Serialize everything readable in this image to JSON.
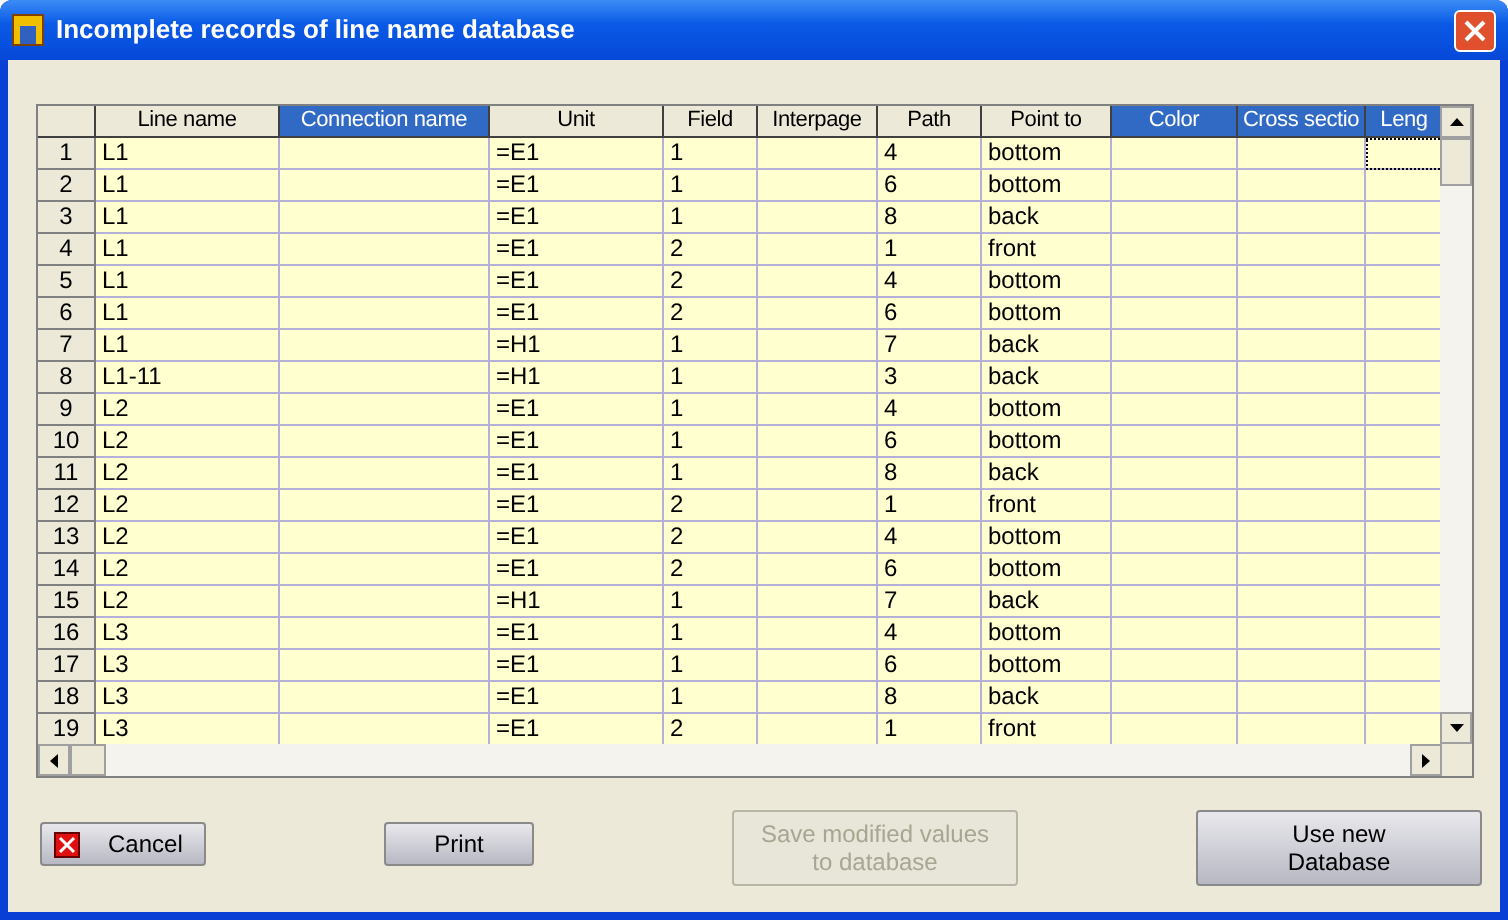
{
  "window": {
    "title": "Incomplete records of line name database"
  },
  "table": {
    "columns": [
      {
        "label": "Line name",
        "selected": false
      },
      {
        "label": "Connection name",
        "selected": true
      },
      {
        "label": "Unit",
        "selected": false
      },
      {
        "label": "Field",
        "selected": false
      },
      {
        "label": "Interpage",
        "selected": false
      },
      {
        "label": "Path",
        "selected": false
      },
      {
        "label": "Point to",
        "selected": false
      },
      {
        "label": "Color",
        "selected": true
      },
      {
        "label": "Cross sectio",
        "selected": true
      },
      {
        "label": "Leng",
        "selected": true
      }
    ],
    "rows": [
      {
        "number": "1",
        "line_name": "L1",
        "unit": "=E1",
        "field": "1",
        "path": "4",
        "point_to": "bottom"
      },
      {
        "number": "2",
        "line_name": "L1",
        "unit": "=E1",
        "field": "1",
        "path": "6",
        "point_to": "bottom"
      },
      {
        "number": "3",
        "line_name": "L1",
        "unit": "=E1",
        "field": "1",
        "path": "8",
        "point_to": "back"
      },
      {
        "number": "4",
        "line_name": "L1",
        "unit": "=E1",
        "field": "2",
        "path": "1",
        "point_to": "front"
      },
      {
        "number": "5",
        "line_name": "L1",
        "unit": "=E1",
        "field": "2",
        "path": "4",
        "point_to": "bottom"
      },
      {
        "number": "6",
        "line_name": "L1",
        "unit": "=E1",
        "field": "2",
        "path": "6",
        "point_to": "bottom"
      },
      {
        "number": "7",
        "line_name": "L1",
        "unit": "=H1",
        "field": "1",
        "path": "7",
        "point_to": "back"
      },
      {
        "number": "8",
        "line_name": "L1-11",
        "unit": "=H1",
        "field": "1",
        "path": "3",
        "point_to": "back"
      },
      {
        "number": "9",
        "line_name": "L2",
        "unit": "=E1",
        "field": "1",
        "path": "4",
        "point_to": "bottom"
      },
      {
        "number": "10",
        "line_name": "L2",
        "unit": "=E1",
        "field": "1",
        "path": "6",
        "point_to": "bottom"
      },
      {
        "number": "11",
        "line_name": "L2",
        "unit": "=E1",
        "field": "1",
        "path": "8",
        "point_to": "back"
      },
      {
        "number": "12",
        "line_name": "L2",
        "unit": "=E1",
        "field": "2",
        "path": "1",
        "point_to": "front"
      },
      {
        "number": "13",
        "line_name": "L2",
        "unit": "=E1",
        "field": "2",
        "path": "4",
        "point_to": "bottom"
      },
      {
        "number": "14",
        "line_name": "L2",
        "unit": "=E1",
        "field": "2",
        "path": "6",
        "point_to": "bottom"
      },
      {
        "number": "15",
        "line_name": "L2",
        "unit": "=H1",
        "field": "1",
        "path": "7",
        "point_to": "back"
      },
      {
        "number": "16",
        "line_name": "L3",
        "unit": "=E1",
        "field": "1",
        "path": "4",
        "point_to": "bottom"
      },
      {
        "number": "17",
        "line_name": "L3",
        "unit": "=E1",
        "field": "1",
        "path": "6",
        "point_to": "bottom"
      },
      {
        "number": "18",
        "line_name": "L3",
        "unit": "=E1",
        "field": "1",
        "path": "8",
        "point_to": "back"
      },
      {
        "number": "19",
        "line_name": "L3",
        "unit": "=E1",
        "field": "2",
        "path": "1",
        "point_to": "front"
      }
    ]
  },
  "buttons": [
    {
      "kind": "cancel",
      "label": "Cancel",
      "disabled": false
    },
    {
      "kind": "print",
      "label": "Print",
      "disabled": false
    },
    {
      "kind": "save",
      "label": "Save modified values to database",
      "disabled": true
    },
    {
      "kind": "use_new",
      "label": "Use new Database",
      "disabled": false
    }
  ]
}
